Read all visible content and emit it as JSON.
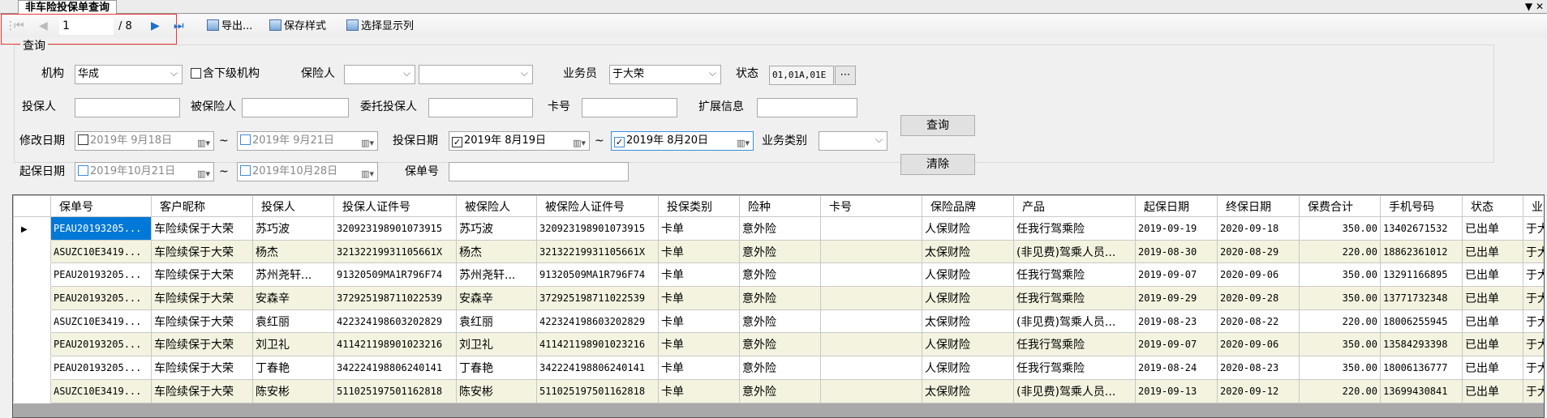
{
  "tab": {
    "title": "非车险投保单查询"
  },
  "toolbar": {
    "current_page": "1",
    "total_pages": "/ 8",
    "export": "导出...",
    "save_style": "保存样式",
    "select_columns": "选择显示列"
  },
  "query": {
    "group_title": "查询",
    "org_label": "机构",
    "org_value": "华成",
    "sub_org_label": "含下级机构",
    "insurer_label": "保险人",
    "insurer_value": "",
    "insurer_value2": "",
    "salesman_label": "业务员",
    "salesman_value": "于大荣",
    "status_label": "状态",
    "status_value": "01,01A,01E",
    "applicant_label": "投保人",
    "insured_label": "被保险人",
    "entrust_label": "委托投保人",
    "card_label": "卡号",
    "ext_label": "扩展信息",
    "modify_date_label": "修改日期",
    "modify_from": "2019年 9月18日",
    "modify_to": "2019年 9月21日",
    "apply_date_label": "投保日期",
    "apply_from": "2019年 8月19日",
    "apply_to": "2019年 8月20日",
    "biz_type_label": "业务类别",
    "start_date_label": "起保日期",
    "start_from": "2019年10月21日",
    "start_to": "2019年10月28日",
    "policy_no_label": "保单号",
    "tilde": "~",
    "search_button": "查询",
    "clear_button": "清除"
  },
  "grid": {
    "columns": [
      "保单号",
      "客户昵称",
      "投保人",
      "投保人证件号",
      "被保险人",
      "被保险人证件号",
      "投保类别",
      "险种",
      "卡号",
      "保险品牌",
      "产品",
      "起保日期",
      "终保日期",
      "保费合计",
      "手机号码",
      "状态",
      "业务员"
    ],
    "rows": [
      [
        "PEAU20193205...",
        "车险续保于大荣",
        "苏巧波",
        "320923198901073915",
        "苏巧波",
        "320923198901073915",
        "卡单",
        "意外险",
        "",
        "人保财险",
        "任我行驾乘险",
        "2019-09-19",
        "2020-09-18",
        "350.00",
        "13402671532",
        "已出单",
        "于大荣"
      ],
      [
        "ASUZC10E3419...",
        "车险续保于大荣",
        "杨杰",
        "32132219931105661X",
        "杨杰",
        "32132219931105661X",
        "卡单",
        "意外险",
        "",
        "太保财险",
        "(非见费)驾乘人员...",
        "2019-08-30",
        "2020-08-29",
        "220.00",
        "18862361012",
        "已出单",
        "于大荣"
      ],
      [
        "PEAU20193205...",
        "车险续保于大荣",
        "苏州尧轩...",
        "91320509MA1R796F74",
        "苏州尧轩...",
        "91320509MA1R796F74",
        "卡单",
        "意外险",
        "",
        "人保财险",
        "任我行驾乘险",
        "2019-09-07",
        "2020-09-06",
        "350.00",
        "13291166895",
        "已出单",
        "于大荣"
      ],
      [
        "PEAU20193205...",
        "车险续保于大荣",
        "安森辛",
        "372925198711022539",
        "安森辛",
        "372925198711022539",
        "卡单",
        "意外险",
        "",
        "人保财险",
        "任我行驾乘险",
        "2019-09-29",
        "2020-09-28",
        "350.00",
        "13771732348",
        "已出单",
        "于大荣"
      ],
      [
        "ASUZC10E3419...",
        "车险续保于大荣",
        "袁红丽",
        "422324198603202829",
        "袁红丽",
        "422324198603202829",
        "卡单",
        "意外险",
        "",
        "太保财险",
        "(非见费)驾乘人员...",
        "2019-08-23",
        "2020-08-22",
        "220.00",
        "18006255945",
        "已出单",
        "于大荣"
      ],
      [
        "PEAU20193205...",
        "车险续保于大荣",
        "刘卫礼",
        "411421198901023216",
        "刘卫礼",
        "411421198901023216",
        "卡单",
        "意外险",
        "",
        "人保财险",
        "任我行驾乘险",
        "2019-09-07",
        "2020-09-06",
        "350.00",
        "13584293398",
        "已出单",
        "于大荣"
      ],
      [
        "PEAU20193205...",
        "车险续保于大荣",
        "丁春艳",
        "342224198806240141",
        "丁春艳",
        "342224198806240141",
        "卡单",
        "意外险",
        "",
        "人保财险",
        "任我行驾乘险",
        "2019-08-24",
        "2020-08-23",
        "350.00",
        "18006136777",
        "已出单",
        "于大荣"
      ],
      [
        "ASUZC10E3419...",
        "车险续保于大荣",
        "陈安彬",
        "511025197501162818",
        "陈安彬",
        "511025197501162818",
        "卡单",
        "意外险",
        "",
        "太保财险",
        "(非见费)驾乘人员...",
        "2019-09-13",
        "2020-09-12",
        "220.00",
        "13699430841",
        "已出单",
        "于大荣"
      ]
    ]
  }
}
